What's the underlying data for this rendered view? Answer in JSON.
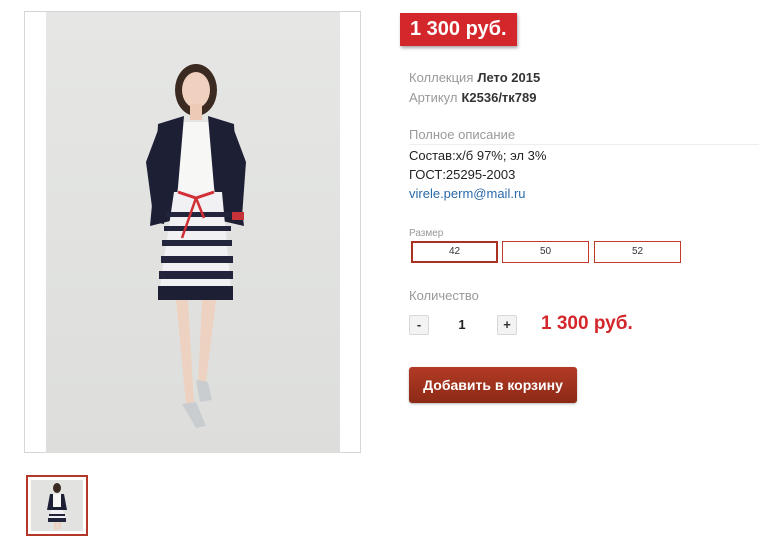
{
  "price_badge": "1 300 руб.",
  "details": {
    "collection_label": "Коллекция",
    "collection_value": "Лето 2015",
    "article_label": "Артикул",
    "article_value": "К2536/тк789"
  },
  "description": {
    "title": "Полное описание",
    "composition": "Состав:х/б 97%; эл 3%",
    "standard": "ГОСТ:25295-2003",
    "email": "virele.perm@mail.ru"
  },
  "sizes": {
    "label": "Размер",
    "options": [
      "42",
      "50",
      "52"
    ],
    "selected": "42"
  },
  "quantity": {
    "label": "Количество",
    "minus": "-",
    "value": "1",
    "plus": "+"
  },
  "total_price": "1 300 руб.",
  "cart_button": "Добавить в корзину",
  "colors": {
    "accent_red": "#d3272c",
    "button_brown": "#9e3220",
    "link_blue": "#2a6aa8"
  }
}
